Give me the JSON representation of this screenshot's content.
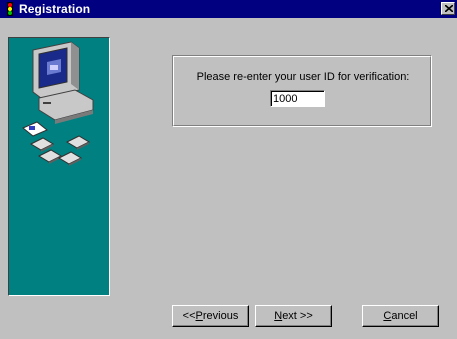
{
  "window": {
    "title": "Registration"
  },
  "form": {
    "prompt": "Please re-enter your user ID for verification:",
    "user_id_value": "1000"
  },
  "buttons": {
    "previous": {
      "prefix": "<<",
      "accel": "P",
      "rest": "revious"
    },
    "next": {
      "accel": "N",
      "rest": "ext >>"
    },
    "cancel": {
      "accel": "C",
      "rest": "ancel"
    }
  },
  "colors": {
    "titlebar": "#000080",
    "face": "#c0c0c0",
    "art_background": "#008080"
  },
  "icons": {
    "title": "traffic-light-icon",
    "close": "close-icon",
    "art": "computer-with-floppy-disks-illustration"
  }
}
